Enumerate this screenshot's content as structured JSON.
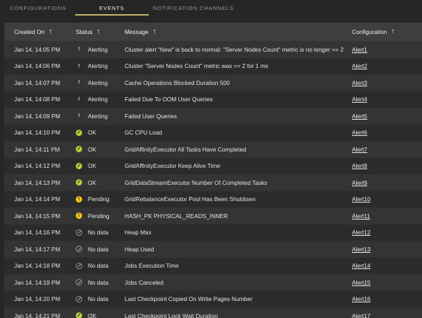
{
  "tabs": [
    {
      "label": "CONFIGURATIONS",
      "active": false
    },
    {
      "label": "EVENTS",
      "active": true
    },
    {
      "label": "NOTIFICATION CHANNELS",
      "active": false
    }
  ],
  "colors": {
    "accent": "#c9b26a",
    "alerting": "#e84131",
    "ok": "#b7cd3a",
    "pending": "#f5c417",
    "nodata": "#9a9a9a"
  },
  "table": {
    "headers": {
      "created_on": "Created On",
      "status": "Status",
      "message": "Message",
      "configuration": "Configuration"
    },
    "sort_icon": "arrow-up-icon",
    "rows": [
      {
        "date": "Jan 14, 14:05 PM",
        "status": "Alerting",
        "status_type": "alerting",
        "message": "Cluster alert \"New\" is back to normal: \"Server Nodes Count\" metric is no longer == 2",
        "config": "Alert1"
      },
      {
        "date": "Jan 14, 14:06 PM",
        "status": "Alerting",
        "status_type": "alerting",
        "message": "Cluster \"Server Nodes Count\" metric was == 2 for 1 ms",
        "config": "Alert2"
      },
      {
        "date": "Jan 14, 14:07 PM",
        "status": "Alerting",
        "status_type": "alerting",
        "message": "Cache Operations Blocked Duration 500",
        "config": "Alert3"
      },
      {
        "date": "Jan 14, 14:08 PM",
        "status": "Alerting",
        "status_type": "alerting",
        "message": "Failed Due To OOM User Queries",
        "config": "Alert4"
      },
      {
        "date": "Jan 14, 14:09 PM",
        "status": "Alerting",
        "status_type": "alerting",
        "message": "Failed User Queries",
        "config": "Alert5"
      },
      {
        "date": "Jan 14, 14:10 PM",
        "status": "OK",
        "status_type": "ok",
        "message": "GC CPU Load",
        "config": "Alert6"
      },
      {
        "date": "Jan 14, 14:11 PM",
        "status": "OK",
        "status_type": "ok",
        "message": "GridAffinityExecutor All Tasks Have Completed",
        "config": "Alert7"
      },
      {
        "date": "Jan 14, 14:12 PM",
        "status": "OK",
        "status_type": "ok",
        "message": "GridAffinityExecutor Keep Alive Time",
        "config": "Alert8"
      },
      {
        "date": "Jan 14, 14:13 PM",
        "status": "OK",
        "status_type": "ok",
        "message": "GridDataStreamExecutor Number Of Completed Tasks",
        "config": "Alert9"
      },
      {
        "date": "Jan 14, 14:14 PM",
        "status": "Pending",
        "status_type": "pending",
        "message": "GridRebalanceExecutor Pool Has Been Shutdown",
        "config": "Alert10"
      },
      {
        "date": "Jan 14, 14:15 PM",
        "status": "Pending",
        "status_type": "pending",
        "message": "HASH_PK PHYSICAL_READS_INNER",
        "config": "Alert11"
      },
      {
        "date": "Jan 14, 14:16 PM",
        "status": "No data",
        "status_type": "nodata",
        "message": "Heap Max",
        "config": "Alert12"
      },
      {
        "date": "Jan 14, 14:17 PM",
        "status": "No data",
        "status_type": "nodata",
        "message": "Heap Used",
        "config": "Alert13"
      },
      {
        "date": "Jan 14, 14:18 PM",
        "status": "No data",
        "status_type": "nodata",
        "message": "Jobs Execution Time",
        "config": "Alert14"
      },
      {
        "date": "Jan 14, 14:19 PM",
        "status": "No data",
        "status_type": "nodata",
        "message": "Jobs Canceled",
        "config": "Alert15"
      },
      {
        "date": "Jan 14, 14:20 PM",
        "status": "No data",
        "status_type": "nodata",
        "message": "Last Checkpoint Copied On Write Pages Number",
        "config": "Alert16"
      },
      {
        "date": "Jan 14, 14:21 PM",
        "status": "OK",
        "status_type": "ok",
        "message": "Last Checkpoint Lock Wait Duration",
        "config": "Alert17"
      }
    ]
  }
}
